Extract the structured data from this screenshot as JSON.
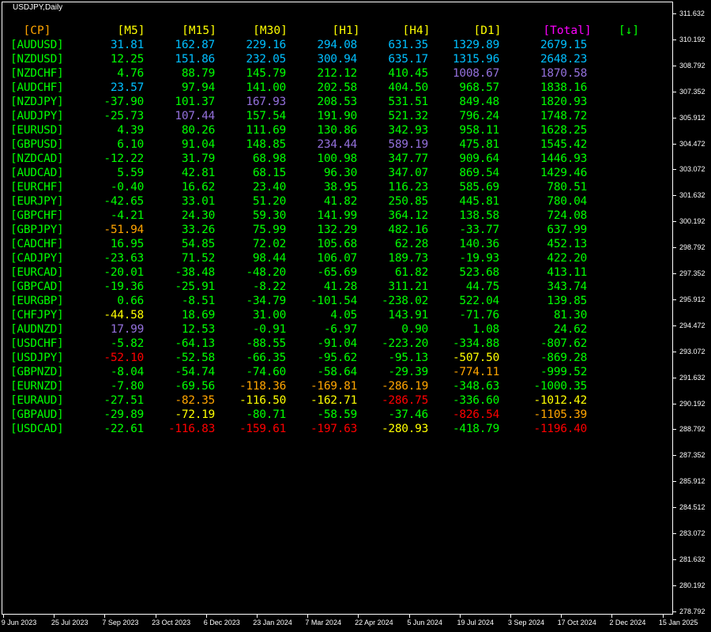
{
  "chart_title": "USDJPY,Daily",
  "colors": {
    "G": "#00ff00",
    "B": "#00bfff",
    "P": "#9370db",
    "O": "#ffa500",
    "Y": "#ffff00",
    "R": "#ff0000",
    "M": "#ff00ff"
  },
  "headers": [
    {
      "label": "[CP]",
      "color": "O"
    },
    {
      "label": "[M5]",
      "color": "Y"
    },
    {
      "label": "[M15]",
      "color": "Y"
    },
    {
      "label": "[M30]",
      "color": "Y"
    },
    {
      "label": "[H1]",
      "color": "Y"
    },
    {
      "label": "[H4]",
      "color": "Y"
    },
    {
      "label": "[D1]",
      "color": "Y"
    },
    {
      "label": "[Total]",
      "color": "M"
    },
    {
      "label": "[↓]",
      "color": "G"
    }
  ],
  "rows": [
    {
      "pair": "[AUDUSD]",
      "values": [
        "31.81",
        "162.87",
        "229.16",
        "294.08",
        "631.35",
        "1329.89",
        "2679.15"
      ],
      "colors": "BBBBBBB"
    },
    {
      "pair": "[NZDUSD]",
      "values": [
        "12.25",
        "151.86",
        "232.05",
        "300.94",
        "635.17",
        "1315.96",
        "2648.23"
      ],
      "colors": "GBBBBBB"
    },
    {
      "pair": "[NZDCHF]",
      "values": [
        "4.76",
        "88.79",
        "145.79",
        "212.12",
        "410.45",
        "1008.67",
        "1870.58"
      ],
      "colors": "GGGGGPP"
    },
    {
      "pair": "[AUDCHF]",
      "values": [
        "23.57",
        "97.94",
        "141.00",
        "202.58",
        "404.50",
        "968.57",
        "1838.16"
      ],
      "colors": "BGGGGGG"
    },
    {
      "pair": "[NZDJPY]",
      "values": [
        "-37.90",
        "101.37",
        "167.93",
        "208.53",
        "531.51",
        "849.48",
        "1820.93"
      ],
      "colors": "GGPGGGG"
    },
    {
      "pair": "[AUDJPY]",
      "values": [
        "-25.73",
        "107.44",
        "157.54",
        "191.90",
        "521.32",
        "796.24",
        "1748.72"
      ],
      "colors": "GPGGGGG"
    },
    {
      "pair": "[EURUSD]",
      "values": [
        "4.39",
        "80.26",
        "111.69",
        "130.86",
        "342.93",
        "958.11",
        "1628.25"
      ],
      "colors": "GGGGGGG"
    },
    {
      "pair": "[GBPUSD]",
      "values": [
        "6.10",
        "91.04",
        "148.85",
        "234.44",
        "589.19",
        "475.81",
        "1545.42"
      ],
      "colors": "GGGPPGG"
    },
    {
      "pair": "[NZDCAD]",
      "values": [
        "-12.22",
        "31.79",
        "68.98",
        "100.98",
        "347.77",
        "909.64",
        "1446.93"
      ],
      "colors": "GGGGGGG"
    },
    {
      "pair": "[AUDCAD]",
      "values": [
        "5.59",
        "42.81",
        "68.15",
        "96.30",
        "347.07",
        "869.54",
        "1429.46"
      ],
      "colors": "GGGGGGG"
    },
    {
      "pair": "[EURCHF]",
      "values": [
        "-0.40",
        "16.62",
        "23.40",
        "38.95",
        "116.23",
        "585.69",
        "780.51"
      ],
      "colors": "GGGGGGG"
    },
    {
      "pair": "[EURJPY]",
      "values": [
        "-42.65",
        "33.01",
        "51.20",
        "41.82",
        "250.85",
        "445.81",
        "780.04"
      ],
      "colors": "GGGGGGG"
    },
    {
      "pair": "[GBPCHF]",
      "values": [
        "-4.21",
        "24.30",
        "59.30",
        "141.99",
        "364.12",
        "138.58",
        "724.08"
      ],
      "colors": "GGGGGGG"
    },
    {
      "pair": "[GBPJPY]",
      "values": [
        "-51.94",
        "33.26",
        "75.99",
        "132.29",
        "482.16",
        "-33.77",
        "637.99"
      ],
      "colors": "OGGGGGG"
    },
    {
      "pair": "[CADCHF]",
      "values": [
        "16.95",
        "54.85",
        "72.02",
        "105.68",
        "62.28",
        "140.36",
        "452.13"
      ],
      "colors": "GGGGGGG"
    },
    {
      "pair": "[CADJPY]",
      "values": [
        "-23.63",
        "71.52",
        "98.44",
        "106.07",
        "189.73",
        "-19.93",
        "422.20"
      ],
      "colors": "GGGGGGG"
    },
    {
      "pair": "[EURCAD]",
      "values": [
        "-20.01",
        "-38.48",
        "-48.20",
        "-65.69",
        "61.82",
        "523.68",
        "413.11"
      ],
      "colors": "GGGGGGG"
    },
    {
      "pair": "[GBPCAD]",
      "values": [
        "-19.36",
        "-25.91",
        "-8.22",
        "41.28",
        "311.21",
        "44.75",
        "343.74"
      ],
      "colors": "GGGGGGG"
    },
    {
      "pair": "[EURGBP]",
      "values": [
        "0.66",
        "-8.51",
        "-34.79",
        "-101.54",
        "-238.02",
        "522.04",
        "139.85"
      ],
      "colors": "GGGGGGG"
    },
    {
      "pair": "[CHFJPY]",
      "values": [
        "-44.58",
        "18.69",
        "31.00",
        "4.05",
        "143.91",
        "-71.76",
        "81.30"
      ],
      "colors": "YGGGGGG"
    },
    {
      "pair": "[AUDNZD]",
      "values": [
        "17.99",
        "12.53",
        "-0.91",
        "-6.97",
        "0.90",
        "1.08",
        "24.62"
      ],
      "colors": "PGGGGGG"
    },
    {
      "pair": "[USDCHF]",
      "values": [
        "-5.82",
        "-64.13",
        "-88.55",
        "-91.04",
        "-223.20",
        "-334.88",
        "-807.62"
      ],
      "colors": "GGGGGGG"
    },
    {
      "pair": "[USDJPY]",
      "values": [
        "-52.10",
        "-52.58",
        "-66.35",
        "-95.62",
        "-95.13",
        "-507.50",
        "-869.28"
      ],
      "colors": "RGGGGYG"
    },
    {
      "pair": "[GBPNZD]",
      "values": [
        "-8.04",
        "-54.74",
        "-74.60",
        "-58.64",
        "-29.39",
        "-774.11",
        "-999.52"
      ],
      "colors": "GGGGGOG"
    },
    {
      "pair": "[EURNZD]",
      "values": [
        "-7.80",
        "-69.56",
        "-118.36",
        "-169.81",
        "-286.19",
        "-348.63",
        "-1000.35"
      ],
      "colors": "GGOOOGG"
    },
    {
      "pair": "[EURAUD]",
      "values": [
        "-27.51",
        "-82.35",
        "-116.50",
        "-162.71",
        "-286.75",
        "-336.60",
        "-1012.42"
      ],
      "colors": "GOYYRGY"
    },
    {
      "pair": "[GBPAUD]",
      "values": [
        "-29.89",
        "-72.19",
        "-80.71",
        "-58.59",
        "-37.46",
        "-826.54",
        "-1105.39"
      ],
      "colors": "GYGGGRO"
    },
    {
      "pair": "[USDCAD]",
      "values": [
        "-22.61",
        "-116.83",
        "-159.61",
        "-197.63",
        "-280.93",
        "-418.79",
        "-1196.40"
      ],
      "colors": "GRRRYGR"
    }
  ],
  "price_axis": [
    "311.632",
    "310.192",
    "308.792",
    "307.352",
    "305.912",
    "304.472",
    "303.072",
    "301.632",
    "300.192",
    "298.792",
    "297.352",
    "295.912",
    "294.472",
    "293.072",
    "291.632",
    "290.192",
    "288.792",
    "287.352",
    "285.912",
    "284.512",
    "283.072",
    "281.632",
    "280.192",
    "278.792"
  ],
  "date_axis": [
    "9 Jun 2023",
    "25 Jul 2023",
    "7 Sep 2023",
    "23 Oct 2023",
    "6 Dec 2023",
    "23 Jan 2024",
    "7 Mar 2024",
    "22 Apr 2024",
    "5 Jun 2024",
    "19 Jul 2024",
    "3 Sep 2024",
    "17 Oct 2024",
    "2 Dec 2024",
    "15 Jan 2025"
  ]
}
